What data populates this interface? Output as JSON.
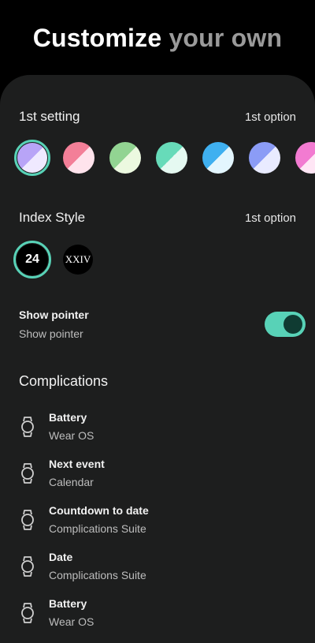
{
  "header": {
    "title_part1": "Customize",
    "title_part2": "your own"
  },
  "setting1": {
    "title": "1st setting",
    "value": "1st option",
    "swatches": [
      {
        "name": "swatch-lavender",
        "colorA": "#b8a4f7",
        "colorB": "#efe9ff",
        "selected": true
      },
      {
        "name": "swatch-pink",
        "colorA": "#f37f98",
        "colorB": "#ffe3ec",
        "selected": false
      },
      {
        "name": "swatch-green",
        "colorA": "#92d492",
        "colorB": "#ecf9e0",
        "selected": false
      },
      {
        "name": "swatch-teal",
        "colorA": "#67dbb9",
        "colorB": "#e5f9f1",
        "selected": false
      },
      {
        "name": "swatch-blue",
        "colorA": "#3fb0f0",
        "colorB": "#e3f6fe",
        "selected": false
      },
      {
        "name": "swatch-periwinkle",
        "colorA": "#8b9cf6",
        "colorB": "#e9ebff",
        "selected": false
      },
      {
        "name": "swatch-magenta",
        "colorA": "#f27bd1",
        "colorB": "#ffe6f5",
        "selected": false
      }
    ]
  },
  "index_style": {
    "title": "Index Style",
    "value": "1st option",
    "option1": "24",
    "option2": "XXIV"
  },
  "pointer": {
    "title": "Show pointer",
    "subtitle": "Show pointer",
    "enabled": true
  },
  "complications": {
    "title": "Complications",
    "items": [
      {
        "name": "Battery",
        "source": "Wear OS"
      },
      {
        "name": "Next event",
        "source": "Calendar"
      },
      {
        "name": "Countdown to date",
        "source": "Complications Suite"
      },
      {
        "name": "Date",
        "source": "Complications Suite"
      },
      {
        "name": "Battery",
        "source": "Wear OS"
      }
    ]
  },
  "colors": {
    "accent": "#58d2b7",
    "sheet_bg": "#1d1e1e",
    "page_bg": "#000000"
  }
}
